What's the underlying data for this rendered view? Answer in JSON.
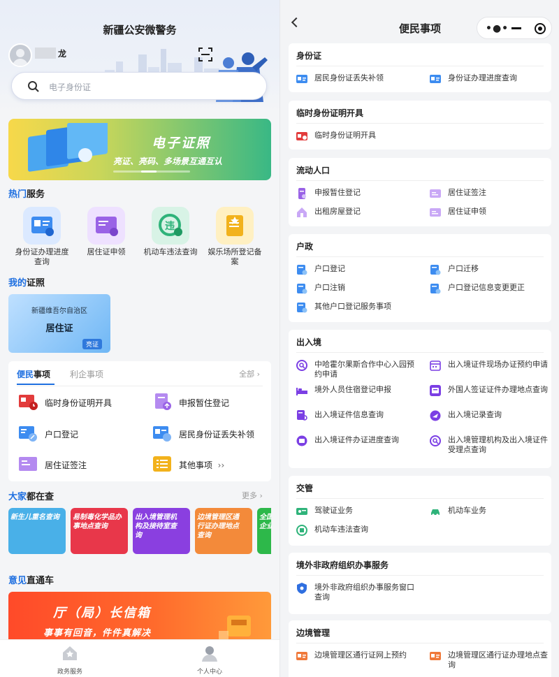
{
  "left": {
    "title": "新疆公安微警务",
    "user_suffix": "龙",
    "search_placeholder": "电子身份证",
    "banner": {
      "title": "电子证照",
      "subtitle": "亮证、亮码、多场景互通互认"
    },
    "hot": {
      "accent": "热门",
      "rest": "服务",
      "items": [
        {
          "label": "身份证办理进度查询",
          "icon": "id-card-icon",
          "color": "#3d8cf0"
        },
        {
          "label": "居住证申领",
          "icon": "residence-card-icon",
          "color": "#9a63e6"
        },
        {
          "label": "机动车违法查询",
          "icon": "traffic-violation-icon",
          "color": "#2fb37a"
        },
        {
          "label": "娱乐场所登记备案",
          "icon": "entertainment-register-icon",
          "color": "#f2b21c"
        }
      ]
    },
    "mycert": {
      "accent": "我的",
      "rest": "证照",
      "region": "新疆维吾尔自治区",
      "name": "居住证",
      "badge": "亮证"
    },
    "services": {
      "tab_active_accent": "便民",
      "tab_active_rest": "事项",
      "tab_other": "利企事项",
      "more": "全部 ›",
      "items": [
        {
          "label": "临时身份证明开具",
          "icon": "temp-id-icon",
          "color": "#e23c3c"
        },
        {
          "label": "申报暂住登记",
          "icon": "temp-residence-icon",
          "color": "#9a63e6"
        },
        {
          "label": "户口登记",
          "icon": "hukou-register-icon",
          "color": "#3d8cf0"
        },
        {
          "label": "居民身份证丢失补领",
          "icon": "id-reissue-icon",
          "color": "#3d8cf0"
        },
        {
          "label": "居住证签注",
          "icon": "residence-endorse-icon",
          "color": "#9a63e6"
        },
        {
          "label": "其他事项",
          "icon": "list-icon",
          "color": "#f2b21c",
          "suffix": "››"
        }
      ]
    },
    "popular": {
      "accent": "大家",
      "rest": "都在查",
      "more": "更多 ›",
      "cards": [
        {
          "text": "新生儿重名查询",
          "color": "#49b0e8"
        },
        {
          "text": "易制毒化学品办事地点查询",
          "color": "#e8374a"
        },
        {
          "text": "出入境管理机构及接待室查询",
          "color": "#8a3fe0"
        },
        {
          "text": "边境管理区通行证办理地点查询",
          "color": "#f38a3a"
        },
        {
          "text": "全国企业",
          "color": "#2db84a"
        }
      ]
    },
    "feedback": {
      "accent": "意见",
      "rest": "直通车",
      "title": "厅（局）长信箱",
      "subtitle": "事事有回音，件件真解决"
    },
    "tabbar": [
      {
        "label": "政务服务",
        "icon": "home-icon"
      },
      {
        "label": "个人中心",
        "icon": "person-icon"
      }
    ]
  },
  "right": {
    "title": "便民事项",
    "sections": [
      {
        "title": "身份证",
        "items": [
          {
            "label": "居民身份证丢失补领",
            "icon": "id-card-icon",
            "color": "#3d8cf0"
          },
          {
            "label": "身份证办理进度查询",
            "icon": "id-card-icon",
            "color": "#3d8cf0"
          }
        ]
      },
      {
        "title": "临时身份证明开具",
        "items": [
          {
            "label": "临时身份证明开具",
            "icon": "temp-id-icon",
            "color": "#e23c3c"
          }
        ]
      },
      {
        "title": "流动人口",
        "items": [
          {
            "label": "申报暂住登记",
            "icon": "temp-residence-icon",
            "color": "#9a63e6"
          },
          {
            "label": "居住证签注",
            "icon": "residence-card-icon",
            "color": "#9a63e6"
          },
          {
            "label": "出租房屋登记",
            "icon": "house-icon",
            "color": "#9a63e6"
          },
          {
            "label": "居住证申领",
            "icon": "residence-card-icon",
            "color": "#9a63e6"
          }
        ]
      },
      {
        "title": "户政",
        "items": [
          {
            "label": "户口登记",
            "icon": "hukou-icon",
            "color": "#3d8cf0"
          },
          {
            "label": "户口迁移",
            "icon": "hukou-icon",
            "color": "#3d8cf0"
          },
          {
            "label": "户口注销",
            "icon": "hukou-icon",
            "color": "#3d8cf0"
          },
          {
            "label": "户口登记信息变更更正",
            "icon": "hukou-icon",
            "color": "#3d8cf0"
          },
          {
            "label": "其他户口登记服务事项",
            "icon": "hukou-icon",
            "color": "#3d8cf0"
          }
        ]
      },
      {
        "title": "出入境",
        "items": [
          {
            "label": "中哈霍尔果斯合作中心入园预约申请",
            "icon": "search-circle-icon",
            "color": "#7b3fe4"
          },
          {
            "label": "出入境证件现场办证预约申请",
            "icon": "calendar-icon",
            "color": "#7b3fe4"
          },
          {
            "label": "境外人员住宿登记申报",
            "icon": "bed-icon",
            "color": "#7b3fe4"
          },
          {
            "label": "外国人签证证件办理地点查询",
            "icon": "visa-icon",
            "color": "#7b3fe4"
          },
          {
            "label": "出入境证件信息查询",
            "icon": "document-search-icon",
            "color": "#7b3fe4"
          },
          {
            "label": "出入境记录查询",
            "icon": "plane-globe-icon",
            "color": "#7b3fe4"
          },
          {
            "label": "出入境证件办证进度查询",
            "icon": "progress-icon",
            "color": "#7b3fe4"
          },
          {
            "label": "出入境管理机构及出入境证件受理点查询",
            "icon": "search-circle-icon",
            "color": "#7b3fe4"
          }
        ]
      },
      {
        "title": "交管",
        "items": [
          {
            "label": "驾驶证业务",
            "icon": "license-icon",
            "color": "#2fb37a"
          },
          {
            "label": "机动车业务",
            "icon": "car-icon",
            "color": "#2fb37a"
          },
          {
            "label": "机动车违法查询",
            "icon": "violation-search-icon",
            "color": "#2fb37a"
          }
        ]
      },
      {
        "title": "境外非政府组织办事服务",
        "items": [
          {
            "label": "境外非政府组织办事服务窗口查询",
            "icon": "shield-icon",
            "color": "#2f6fe0"
          }
        ]
      },
      {
        "title": "边境管理",
        "items": [
          {
            "label": "边境管理区通行证网上预约",
            "icon": "border-pass-icon",
            "color": "#f0793a"
          },
          {
            "label": "边境管理区通行证办理地点查询",
            "icon": "border-pass-icon",
            "color": "#f0793a"
          }
        ]
      }
    ]
  }
}
